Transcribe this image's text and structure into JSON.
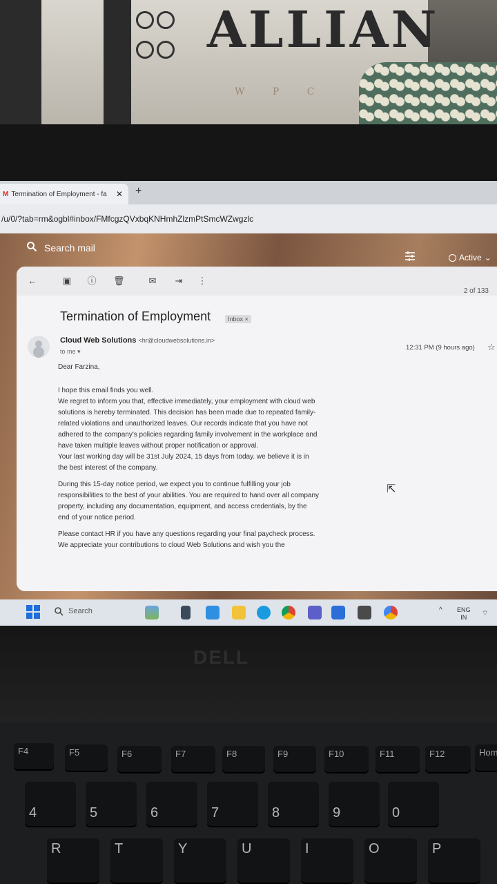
{
  "browser": {
    "tab_title": "Termination of Employment - fa",
    "tab_close": "✕",
    "new_tab": "+",
    "url": "/u/0/?tab=rm&ogbl#inbox/FMfcgzQVxbqKNHmhZlzmPtSmcWZwgzlc"
  },
  "gmail": {
    "search_placeholder": "Search mail",
    "status": "Active",
    "counter": "2 of 133",
    "email": {
      "subject": "Termination of Employment",
      "label": "Inbox",
      "sender_name": "Cloud Web Solutions",
      "sender_email": "<hr@cloudwebsolutions.in>",
      "recipient": "to me",
      "time": "12:31 PM (9 hours ago)",
      "greeting": "Dear Farzina,",
      "paragraphs": [
        "I hope this email finds you well.",
        "We regret to inform you that, effective immediately, your employment with cloud web solutions is hereby terminated. This decision has been made due to repeated family-related violations and unauthorized leaves. Our records indicate that you have not adhered to the company's policies regarding family involvement in the workplace and have taken multiple leaves without proper notification or approval.",
        "Your last working day will be 31st July 2024, 15 days from today. we believe it is in the best interest of the company.",
        "During this 15-day notice period, we expect you to continue fulfilling your job responsibilities to the best of your abilities. You are required to hand over all company property, including any documentation, equipment, and access credentials, by the end of your notice period.",
        "Please contact HR if you have any questions regarding your final paycheck process.",
        "We appreciate your contributions to cloud Web Solutions and wish you the"
      ]
    }
  },
  "taskbar": {
    "search_label": "Search",
    "lang_top": "ENG",
    "lang_bottom": "IN"
  },
  "background": {
    "poster_text": "ALLIAN",
    "poster_sub": "W P C",
    "brand": "DELL"
  },
  "keyboard": {
    "fn_keys": [
      "F4",
      "F5",
      "F6",
      "F7",
      "F8",
      "F9",
      "F10",
      "F11",
      "F12",
      "Hom"
    ],
    "num_keys": [
      "4",
      "5",
      "6",
      "7",
      "8",
      "9",
      "0"
    ],
    "alpha_keys": [
      "R",
      "T",
      "Y",
      "U",
      "I",
      "O",
      "P"
    ]
  },
  "colors": {
    "gmail_red": "#d93025",
    "windows_blue": "#1e6fd9"
  }
}
